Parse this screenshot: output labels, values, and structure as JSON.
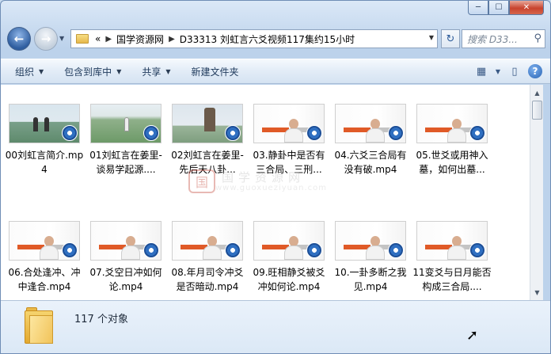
{
  "window": {
    "minimize": "─",
    "maximize": "☐",
    "close": "✕"
  },
  "nav": {
    "back": "←",
    "forward": "→",
    "history_dropdown": "▼"
  },
  "address": {
    "crumbs": [
      "«",
      "国学资源网",
      "D33313 刘虹言六爻视频117集约15小时"
    ],
    "separator": "▶",
    "dropdown": "▼"
  },
  "refresh": "↻",
  "search": {
    "placeholder": "搜索 D33...",
    "icon": "⚲"
  },
  "toolbar": {
    "organize": "组织",
    "include_in_library": "包含到库中",
    "share": "共享",
    "new_folder": "新建文件夹",
    "help": "?"
  },
  "files": [
    {
      "name": "00刘虹言简介.mp4",
      "thumb": "out"
    },
    {
      "name": "01刘虹言在姜里-谈易学起源....",
      "thumb": "park"
    },
    {
      "name": "02刘虹言在姜里-先后天八卦...",
      "thumb": "statue"
    },
    {
      "name": "03.静卦中是否有三合局、三刑...",
      "thumb": "room"
    },
    {
      "name": "04.六爻三合局有没有破.mp4",
      "thumb": "room"
    },
    {
      "name": "05.世爻或用神入墓，如何出墓...",
      "thumb": "room"
    },
    {
      "name": "06.合处逢冲、冲中逢合.mp4",
      "thumb": "room"
    },
    {
      "name": "07.爻空日冲如何论.mp4",
      "thumb": "room"
    },
    {
      "name": "08.年月司令冲爻是否暗动.mp4",
      "thumb": "room"
    },
    {
      "name": "09.旺相静爻被爻冲如何论.mp4",
      "thumb": "room"
    },
    {
      "name": "10.一卦多断之我见.mp4",
      "thumb": "room"
    },
    {
      "name": "11变爻与日月能否构成三合局....",
      "thumb": "room"
    }
  ],
  "watermark": {
    "logo": "国",
    "text": "国学资源网",
    "url": "www.guoxueziyuan.com"
  },
  "status": {
    "count": "117 个对象"
  }
}
